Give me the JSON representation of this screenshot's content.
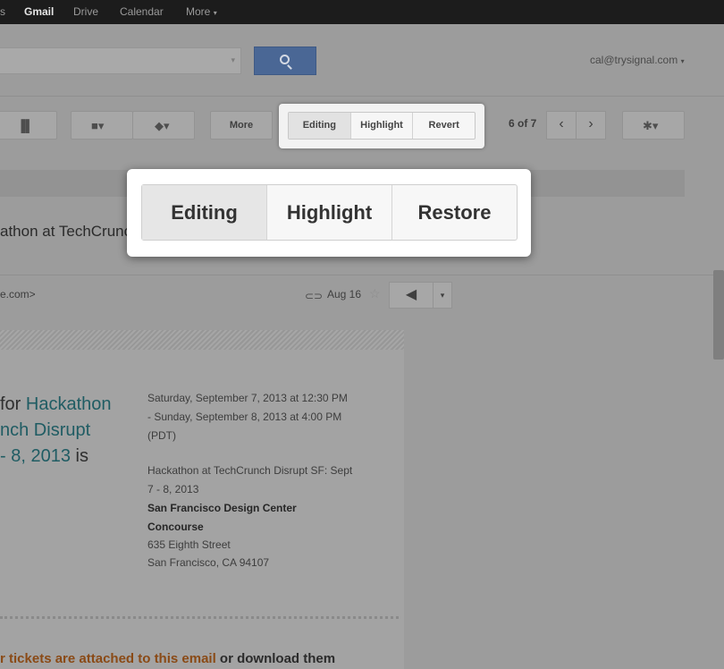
{
  "topnav": {
    "partial": "s",
    "gmail": "Gmail",
    "drive": "Drive",
    "calendar": "Calendar",
    "more": "More"
  },
  "account": {
    "email": "cal@trysignal.com"
  },
  "toolbar": {
    "more_label": "More",
    "pager": "6 of 7"
  },
  "small_popup": {
    "buttons": [
      "Editing",
      "Highlight",
      "Revert"
    ]
  },
  "big_popup": {
    "buttons": [
      "Editing",
      "Highlight",
      "Restore"
    ]
  },
  "message": {
    "subject": "athon at TechCrunch",
    "sender": "e.com>",
    "date": "Aug 16"
  },
  "event": {
    "lead_line1_pre": "for ",
    "lead_line1_link": "Hackathon",
    "lead_line2_link": "nch Disrupt",
    "lead_line3_link": "- 8, 2013",
    "lead_line3_post": " is",
    "when_line1": "Saturday, September 7, 2013 at 12:30 PM",
    "when_line2": "- Sunday, September 8, 2013 at 4:00 PM",
    "when_line3": "(PDT)",
    "what_line1": "Hackathon at TechCrunch Disrupt SF: Sept",
    "what_line2": "7 - 8, 2013",
    "venue_line1": "San Francisco Design Center",
    "venue_line2": "Concourse",
    "street": "635 Eighth Street",
    "city": "San Francisco, CA 94107"
  },
  "tickets": {
    "link_text": "r tickets are attached to this email",
    "rest_text": " or download them"
  },
  "icons": [
    "search-icon",
    "trash-icon",
    "folder-icon",
    "label-icon",
    "gear-icon",
    "attachment-icon",
    "star-icon",
    "reply-icon"
  ]
}
